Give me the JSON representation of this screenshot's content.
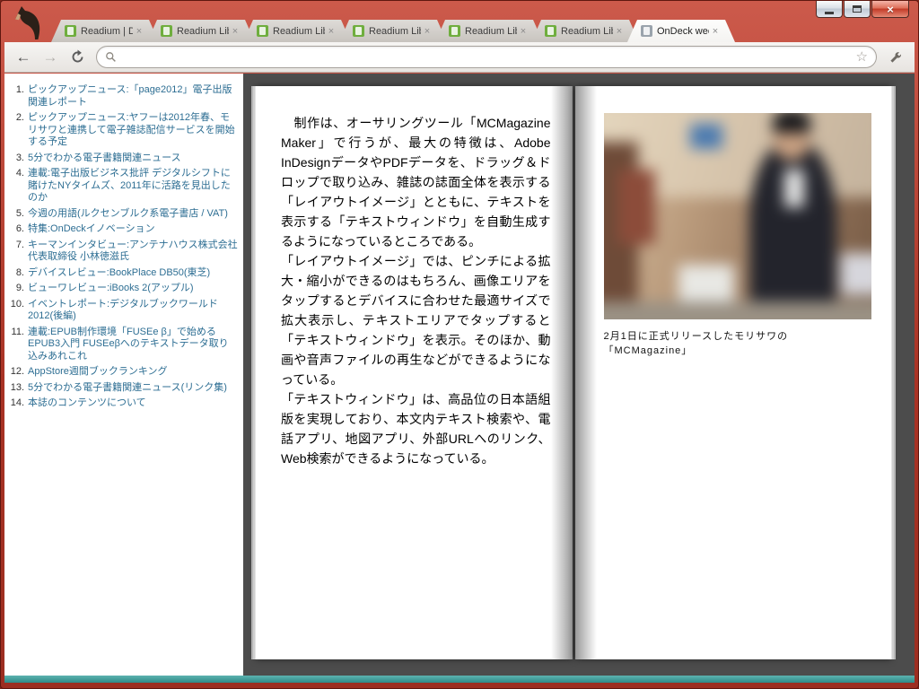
{
  "icons": {
    "tab_close": "×",
    "window_close": "×",
    "back": "←",
    "forward": "→",
    "star": "☆"
  },
  "colors": {
    "frame_red": "#a93325",
    "readium_green": "#6fae3e",
    "ondeck_gray": "#9aa3ac",
    "toc_link": "#2d6e93",
    "bottom_bar_teal": "#2f8a87",
    "book_background": "#4c4c4c"
  },
  "tabs": [
    {
      "label": "Readium | D",
      "active": false,
      "favicon_color": "#6fae3e"
    },
    {
      "label": "Readium Lib",
      "active": false,
      "favicon_color": "#6fae3e"
    },
    {
      "label": "Readium Lib",
      "active": false,
      "favicon_color": "#6fae3e"
    },
    {
      "label": "Readium Lib",
      "active": false,
      "favicon_color": "#6fae3e"
    },
    {
      "label": "Readium Lib",
      "active": false,
      "favicon_color": "#6fae3e"
    },
    {
      "label": "Readium Lib",
      "active": false,
      "favicon_color": "#6fae3e"
    },
    {
      "label": "OnDeck wee",
      "active": true,
      "favicon_color": "#9aa3ac"
    }
  ],
  "toolbar": {
    "address_value": "",
    "address_placeholder": ""
  },
  "toc": {
    "items": [
      {
        "num": "1.",
        "text": "ピックアップニュース:「page2012」電子出版関連レポート"
      },
      {
        "num": "2.",
        "text": "ピックアップニュース:ヤフーは2012年春、モリサワと連携して電子雑誌配信サービスを開始する予定"
      },
      {
        "num": "3.",
        "text": "5分でわかる電子書籍関連ニュース"
      },
      {
        "num": "4.",
        "text": "連載:電子出版ビジネス批評 デジタルシフトに賭けたNYタイムズ、2011年に活路を見出したのか"
      },
      {
        "num": "5.",
        "text": "今週の用語(ルクセンブルク系電子書店 / VAT)"
      },
      {
        "num": "6.",
        "text": "特集:OnDeckイノベーション"
      },
      {
        "num": "7.",
        "text": "キーマンインタビュー:アンテナハウス株式会社 代表取締役 小林徳滋氏"
      },
      {
        "num": "8.",
        "text": "デバイスレビュー:BookPlace DB50(東芝)"
      },
      {
        "num": "9.",
        "text": "ビューワレビュー:iBooks 2(アップル)"
      },
      {
        "num": "10.",
        "text": "イベントレポート:デジタルブックワールド2012(後編)"
      },
      {
        "num": "11.",
        "text": "連載:EPUB制作環境「FUSEe β」で始めるEPUB3入門 FUSEeβへのテキストデータ取り込みあれこれ"
      },
      {
        "num": "12.",
        "text": "AppStore週間ブックランキング"
      },
      {
        "num": "13.",
        "text": "5分でわかる電子書籍関連ニュース(リンク集)"
      },
      {
        "num": "14.",
        "text": "本誌のコンテンツについて"
      }
    ]
  },
  "book": {
    "paragraphs": [
      "　制作は、オーサリングツール「MCMagazine Maker」で行うが、最大の特徴は、Adobe InDesignデータやPDFデータを、ドラッグ＆ドロップで取り込み、雑誌の誌面全体を表示する「レイアウトイメージ」とともに、テキストを表示する「テキストウィンドウ」を自動生成するようになっているところである。",
      "「レイアウトイメージ」では、ピンチによる拡大・縮小ができるのはもちろん、画像エリアをタップするとデバイスに合わせた最適サイズで拡大表示し、テキストエリアでタップすると「テキストウィンドウ」を表示。そのほか、動画や音声ファイルの再生などができるようになっている。",
      "「テキストウィンドウ」は、高品位の日本語組版を実現しており、本文内テキスト検索や、電話アプリ、地図アプリ、外部URLへのリンク、Web検索ができるようになっている。"
    ],
    "caption": "2月1日に正式リリースしたモリサワの「MCMagazine」"
  }
}
